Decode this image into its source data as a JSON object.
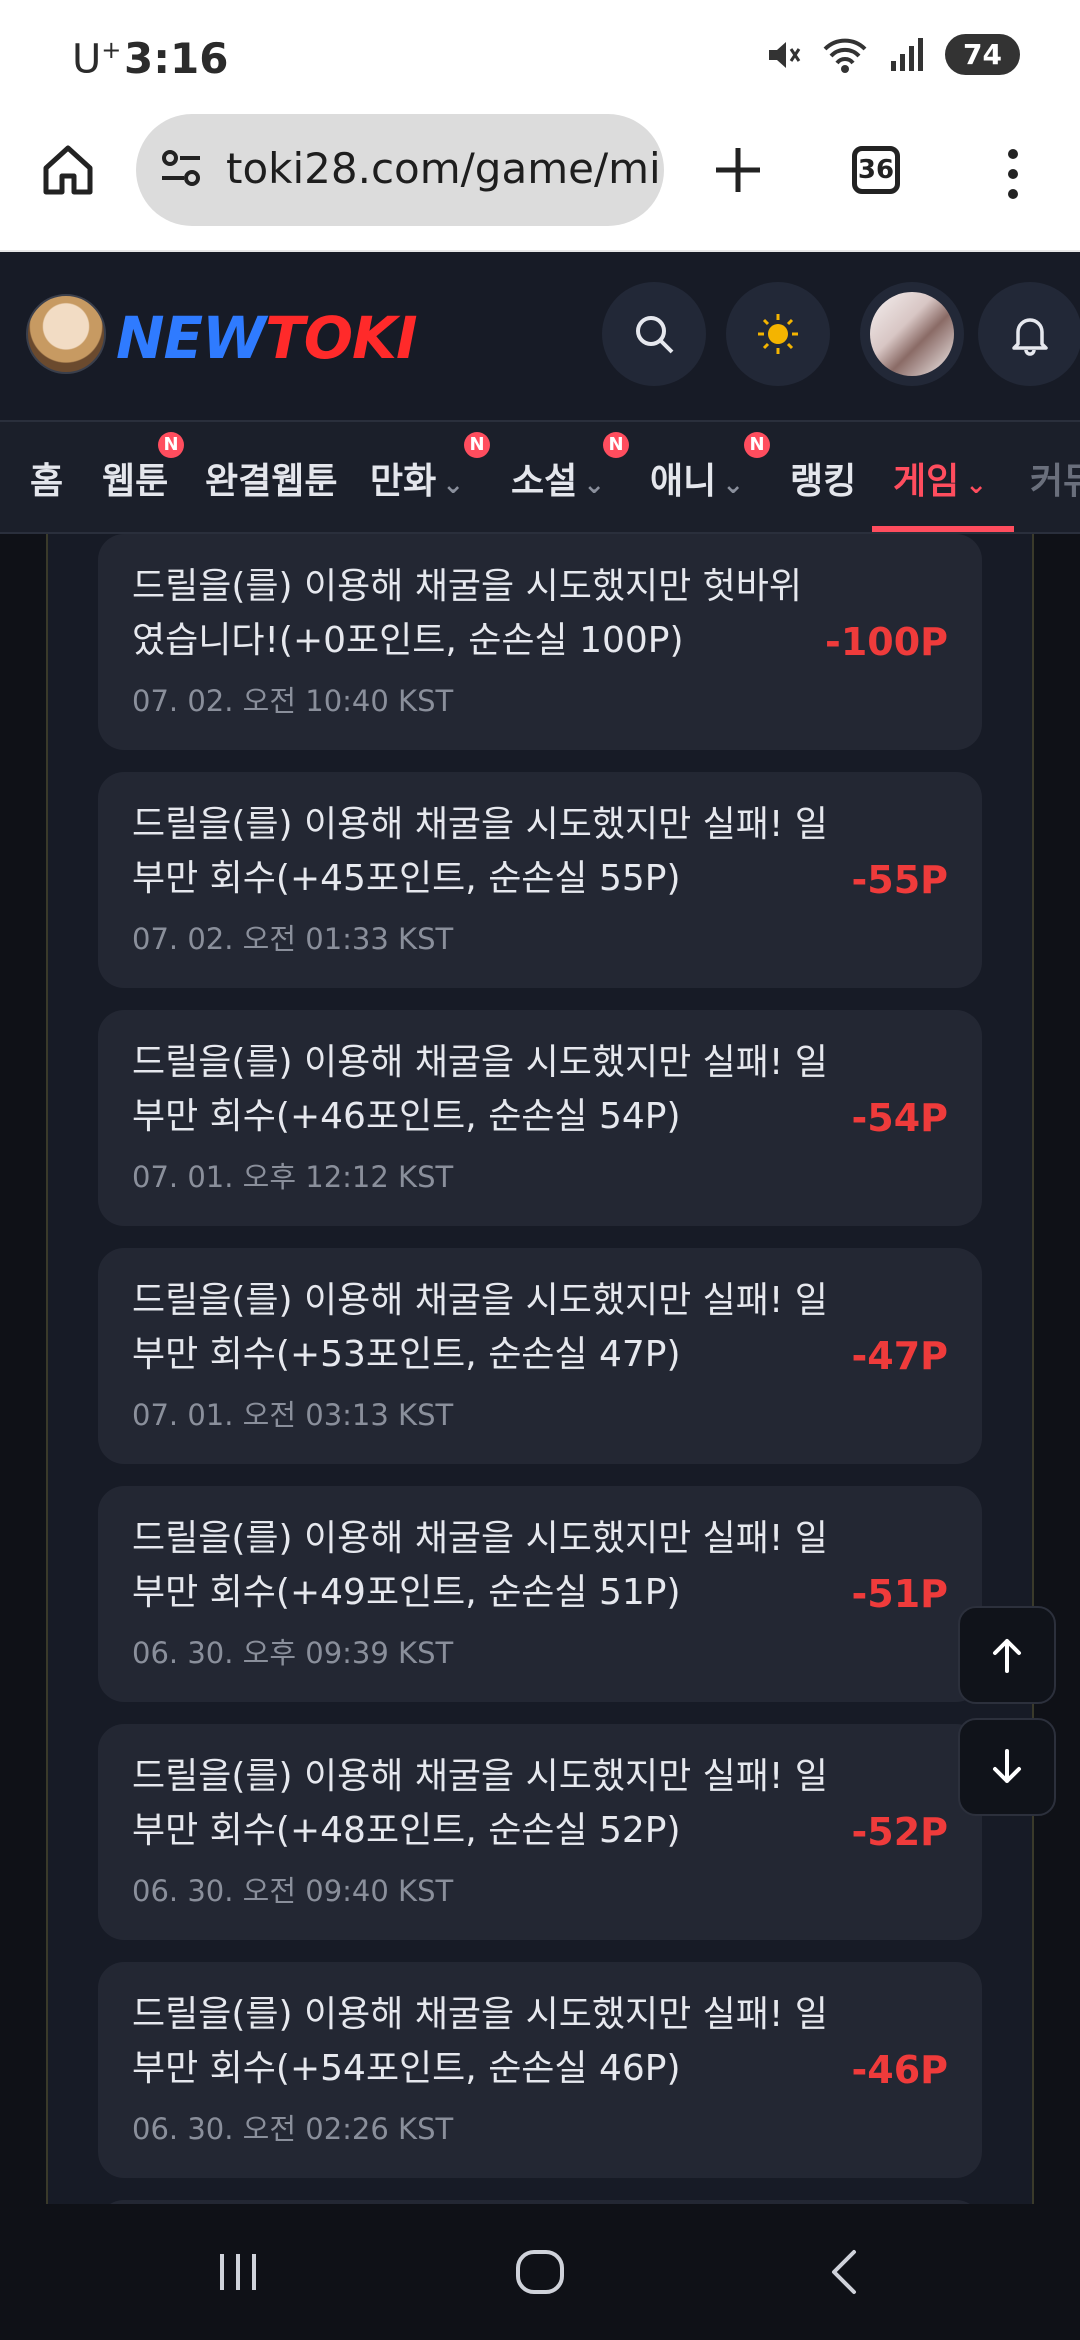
{
  "status_bar": {
    "carrier": "U",
    "carrier_sup": "+",
    "time": "3:16",
    "battery": "74"
  },
  "browser": {
    "url": "toki28.com/game/mi",
    "tab_count": "36"
  },
  "site": {
    "logo_new": "NEW",
    "logo_toki": "TOKI"
  },
  "nav": {
    "items": [
      {
        "label": "홈"
      },
      {
        "label": "웹툰",
        "badge": "N"
      },
      {
        "label": "완결웹툰"
      },
      {
        "label": "만화",
        "badge": "N",
        "dropdown": "⌄"
      },
      {
        "label": "소설",
        "badge": "N",
        "dropdown": "⌄"
      },
      {
        "label": "애니",
        "badge": "N",
        "dropdown": "⌄"
      },
      {
        "label": "랭킹"
      },
      {
        "label": "게임",
        "dropdown": "⌄",
        "active": true
      }
    ],
    "more_label": "커뮤"
  },
  "logs": [
    {
      "message": "드릴을(를) 이용해 채굴을 시도했지만 헛바위였습니다!(+0포인트, 순손실 100P)",
      "time": "07. 02. 오전 10:40 KST",
      "points": "-100P"
    },
    {
      "message": "드릴을(를) 이용해 채굴을 시도했지만 실패! 일부만 회수(+45포인트, 순손실 55P)",
      "time": "07. 02. 오전 01:33 KST",
      "points": "-55P"
    },
    {
      "message": "드릴을(를) 이용해 채굴을 시도했지만 실패! 일부만 회수(+46포인트, 순손실 54P)",
      "time": "07. 01. 오후 12:12 KST",
      "points": "-54P"
    },
    {
      "message": "드릴을(를) 이용해 채굴을 시도했지만 실패! 일부만 회수(+53포인트, 순손실 47P)",
      "time": "07. 01. 오전 03:13 KST",
      "points": "-47P"
    },
    {
      "message": "드릴을(를) 이용해 채굴을 시도했지만 실패! 일부만 회수(+49포인트, 순손실 51P)",
      "time": "06. 30. 오후 09:39 KST",
      "points": "-51P"
    },
    {
      "message": "드릴을(를) 이용해 채굴을 시도했지만 실패! 일부만 회수(+48포인트, 순손실 52P)",
      "time": "06. 30. 오전 09:40 KST",
      "points": "-52P"
    },
    {
      "message": "드릴을(를) 이용해 채굴을 시도했지만 실패! 일부만 회수(+54포인트, 순손실 46P)",
      "time": "06. 30. 오전 02:26 KST",
      "points": "-46P"
    }
  ],
  "colors": {
    "accent": "#ff4d5e",
    "loss": "#ef3b3b",
    "card": "#232733",
    "header": "#171b26"
  }
}
